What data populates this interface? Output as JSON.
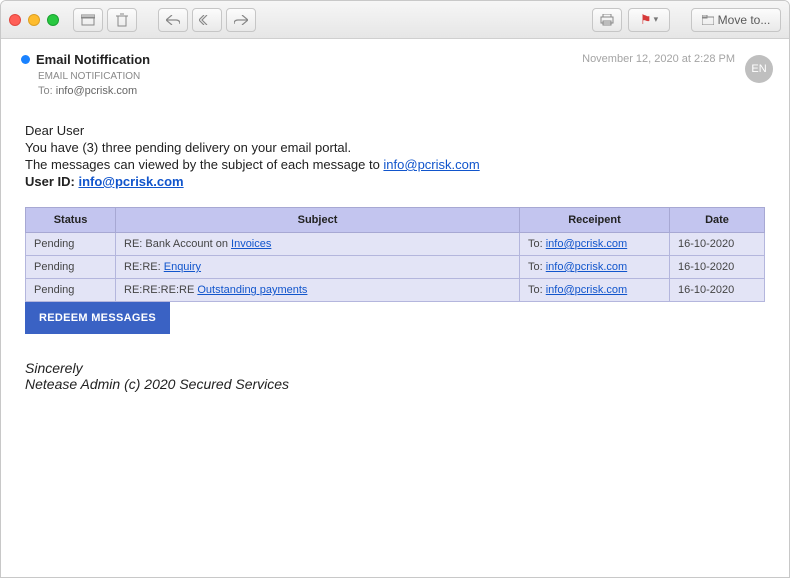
{
  "titlebar": {
    "move_label": "Move to..."
  },
  "header": {
    "sender": "Email Notiffication",
    "subsender": "EMAIL NOTIFICATION",
    "to_label": "To:",
    "to_value": "info@pcrisk.com",
    "datetime": "November 12, 2020 at 2:28 PM",
    "avatar": "EN"
  },
  "body": {
    "greeting": "Dear User",
    "line2_a": "You have (3) three pending delivery on your email portal.",
    "line3_a": "The messages can viewed by the subject of each message to ",
    "line3_link": "info@pcrisk.com",
    "userid_label": "User ID: ",
    "userid_link": "info@pcrisk.com"
  },
  "table": {
    "headers": {
      "status": "Status",
      "subject": "Subject",
      "recipient": "Receipent",
      "date": "Date"
    },
    "rows": [
      {
        "status": "Pending",
        "subject_prefix": "RE: Bank Account on ",
        "subject_link": "Invoices",
        "to_label": "To: ",
        "to_link": "info@pcrisk.com",
        "date": "16-10-2020"
      },
      {
        "status": "Pending",
        "subject_prefix": "RE:RE: ",
        "subject_link": "Enquiry",
        "to_label": "To: ",
        "to_link": "info@pcrisk.com",
        "date": "16-10-2020"
      },
      {
        "status": "Pending",
        "subject_prefix": "RE:RE:RE:RE ",
        "subject_link": "Outstanding payments",
        "to_label": "To: ",
        "to_link": "info@pcrisk.com",
        "date": "16-10-2020"
      }
    ]
  },
  "button": {
    "redeem": "REDEEM MESSAGES"
  },
  "signature": {
    "line1": "Sincerely",
    "line2": "Netease Admin (c) 2020 Secured Services"
  }
}
